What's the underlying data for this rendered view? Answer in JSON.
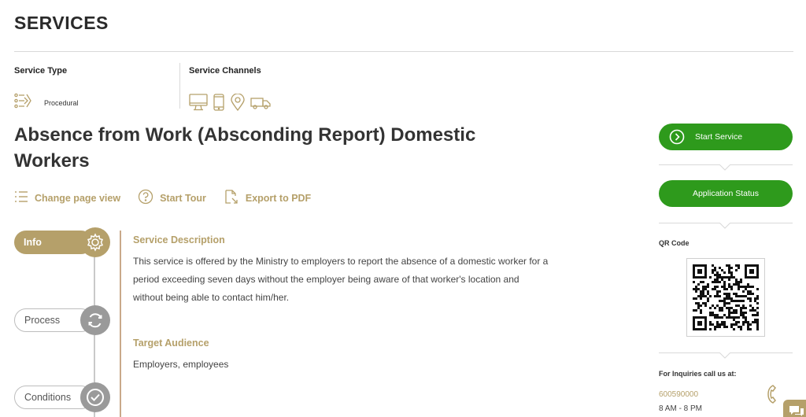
{
  "header": {
    "title": "SERVICES"
  },
  "meta": {
    "service_type_label": "Service Type",
    "service_type_value": "Procedural",
    "service_channels_label": "Service Channels",
    "channels": [
      "desktop-icon",
      "mobile-icon",
      "location-pin-icon",
      "delivery-truck-icon"
    ]
  },
  "service": {
    "title": "Absence from Work (Absconding Report) Domestic Workers"
  },
  "actions": {
    "change_view": "Change page view",
    "start_tour": "Start Tour",
    "export_pdf": "Export to PDF"
  },
  "steps": [
    {
      "label": "Info",
      "icon": "gear-icon",
      "active": true
    },
    {
      "label": "Process",
      "icon": "refresh-icon",
      "active": false
    },
    {
      "label": "Conditions",
      "icon": "check-circle-icon",
      "active": false
    }
  ],
  "sections": {
    "description_title": "Service Description",
    "description_body": "This service is offered by the Ministry to employers to report the absence of a domestic worker for a period exceeding seven days without the employer being aware of that worker's location and without being able to contact him/her.",
    "audience_title": "Target Audience",
    "audience_body": "Employers, employees"
  },
  "sidebar": {
    "start_service": "Start Service",
    "application_status": "Application Status",
    "qr_label": "QR Code",
    "inquiries_label": "For Inquiries call us at:",
    "phone": "600590000",
    "hours": "8 AM - 8 PM"
  },
  "colors": {
    "accent": "#b5a06a",
    "green": "#2e9a1c"
  }
}
